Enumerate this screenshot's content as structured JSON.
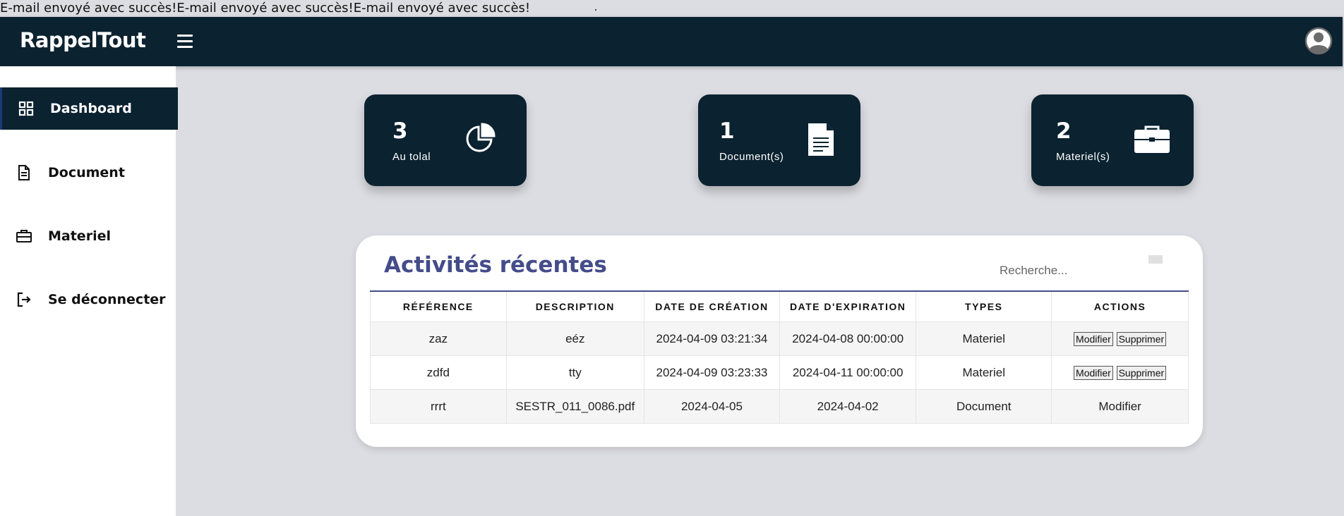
{
  "flash_message": "E-mail envoyé avec succès!E-mail envoyé avec succès!E-mail envoyé avec succès!",
  "header": {
    "brand": "RappelTout"
  },
  "sidebar": {
    "items": [
      {
        "label": "Dashboard",
        "icon": "grid-icon",
        "active": true
      },
      {
        "label": "Document",
        "icon": "document-icon"
      },
      {
        "label": "Materiel",
        "icon": "toolbox-icon"
      },
      {
        "label": "Se déconnecter",
        "icon": "logout-icon"
      }
    ]
  },
  "cards": [
    {
      "value": "3",
      "caption": "Au tolal",
      "icon": "pie-chart-icon"
    },
    {
      "value": "1",
      "caption": "Document(s)",
      "icon": "document-icon"
    },
    {
      "value": "2",
      "caption": "Materiel(s)",
      "icon": "briefcase-icon"
    }
  ],
  "activities": {
    "title": "Activités récentes",
    "search_placeholder": "Recherche...",
    "columns": [
      "RÉFÉRENCE",
      "DESCRIPTION",
      "DATE DE CRÉATION",
      "DATE D'EXPIRATION",
      "TYPES",
      "ACTIONS"
    ],
    "rows": [
      {
        "ref": "zaz",
        "desc": "eéz",
        "created": "2024-04-09 03:21:34",
        "expires": "2024-04-08 00:00:00",
        "type": "Materiel",
        "edit": "Modifier",
        "delete": "Supprimer"
      },
      {
        "ref": "zdfd",
        "desc": "tty",
        "created": "2024-04-09 03:23:33",
        "expires": "2024-04-11 00:00:00",
        "type": "Materiel",
        "edit": "Modifier",
        "delete": "Supprimer"
      },
      {
        "ref": "rrrt",
        "desc": "SESTR_011_0086.pdf",
        "created": "2024-04-05",
        "expires": "2024-04-02",
        "type": "Document",
        "edit": "Modifier"
      }
    ]
  },
  "colors": {
    "navy": "#0b2230",
    "accent": "#444c8a",
    "background": "#dcdde2"
  }
}
